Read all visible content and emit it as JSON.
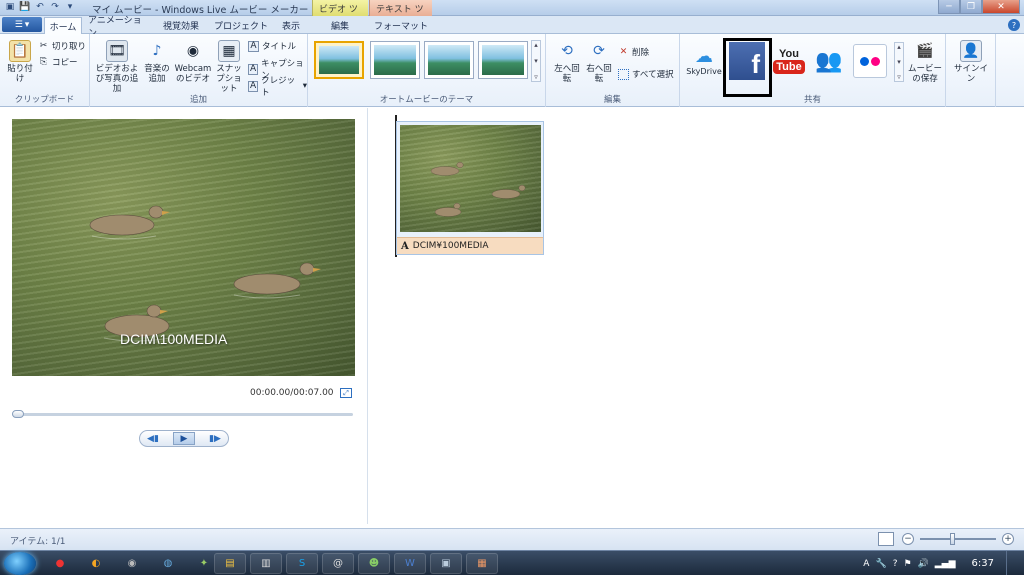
{
  "window": {
    "title": "マイ ムービー - Windows Live ムービー メーカー",
    "context_tabs": {
      "video_tools": "ビデオ ツール",
      "text_tools": "テキスト ツール"
    },
    "controls": {
      "minimize": "─",
      "maximize": "❐",
      "close": "✕"
    }
  },
  "tabs": [
    {
      "label": "ホーム",
      "active": true
    },
    {
      "label": "アニメーション"
    },
    {
      "label": "視覚効果"
    },
    {
      "label": "プロジェクト"
    },
    {
      "label": "表示"
    },
    {
      "label": "編集"
    },
    {
      "label": "フォーマット"
    }
  ],
  "ribbon": {
    "clipboard": {
      "label": "クリップボード",
      "paste": "貼り付け",
      "cut": "切り取り",
      "copy": "コピー"
    },
    "add": {
      "label": "追加",
      "add_video_photos": "ビデオおよび写真の追加",
      "add_music": "音楽の追加",
      "webcam_video": "Webcam のビデオ",
      "snapshot": "スナップショット",
      "title": "タイトル",
      "caption": "キャプション",
      "credits": "クレジット"
    },
    "automovie_themes": {
      "label": "オートムービーのテーマ"
    },
    "edit": {
      "label": "編集",
      "rotate_left": "左へ回転",
      "rotate_right": "右へ回転",
      "delete": "削除",
      "select_all": "すべて選択"
    },
    "share": {
      "label": "共有",
      "skydrive": "SkyDrive",
      "save_movie": "ムービーの保存",
      "sign_in": "サインイン"
    }
  },
  "preview": {
    "overlay_text": "DCIM\\100MEDIA",
    "timecode": "00:00.00/00:07.00"
  },
  "storyboard": {
    "clip_caption": "DCIM¥100MEDIA"
  },
  "status": {
    "items": "アイテム: 1/1"
  },
  "taskbar": {
    "clock": "6:37"
  },
  "colors": {
    "ribbon_bg": "#e8f0fa",
    "accent_blue": "#2d6fc0",
    "facebook": "#3b5998",
    "youtube_red": "#d9261b",
    "caption_bar": "#f7dcc0"
  }
}
